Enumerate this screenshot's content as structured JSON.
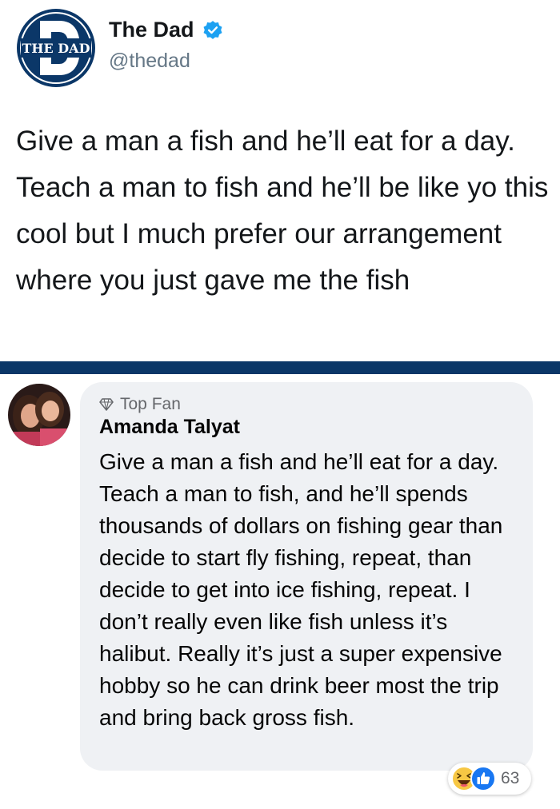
{
  "tweet": {
    "logo_text": "THE DAD",
    "author_name": "The Dad",
    "author_handle": "@thedad",
    "text": "Give a man a fish and he’ll eat for a day. Teach a man to fish and he’ll be like yo this cool but I much prefer our arrangement where you just gave me the fish"
  },
  "comment": {
    "badge": "Top Fan",
    "name": "Amanda Talyat",
    "text": "Give a man a fish and he’ll eat for a day. Teach a man to fish, and he’ll spends thousands of dollars on fishing gear than decide to start fly fishing, repeat, than decide to get into ice fishing, repeat. I don’t really even like fish unless it’s halibut. Really it’s just a super expensive hobby so he can drink beer most the trip and bring back gross fish.",
    "reactions": {
      "icons": [
        "haha-emoji-icon",
        "like-thumb-icon"
      ],
      "count": "63"
    }
  },
  "colors": {
    "divider": "#0b3768",
    "twitter_blue": "#1da1f2",
    "bubble": "#eff1f4",
    "logo_navy": "#0b3768"
  }
}
